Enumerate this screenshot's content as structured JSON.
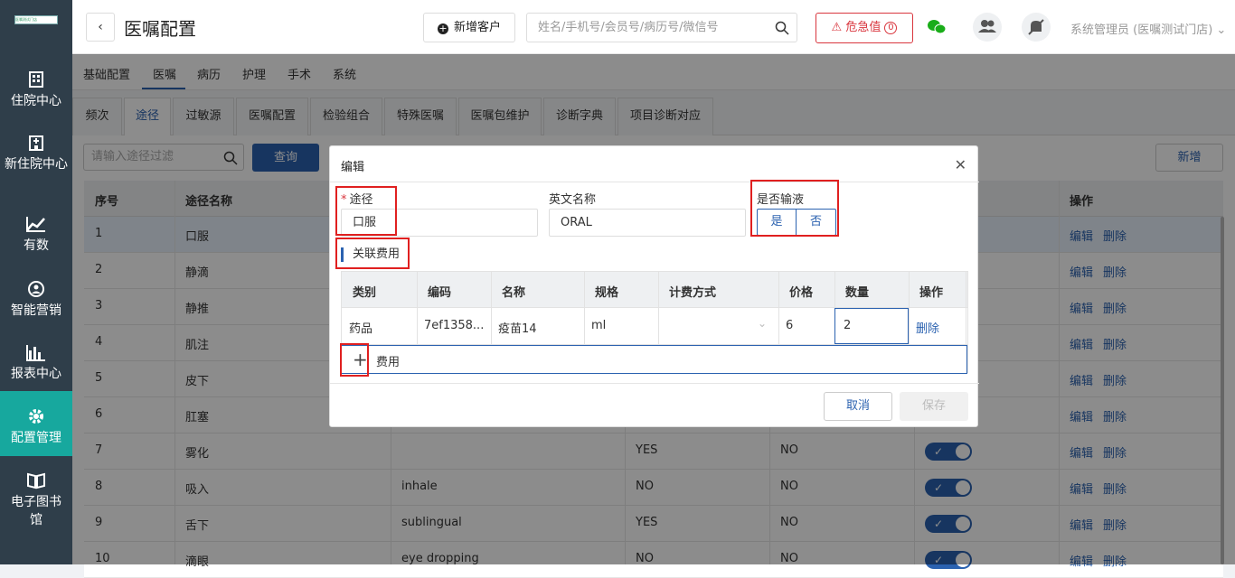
{
  "logo_text": "医嘱测试门店",
  "sidebar": {
    "items": [
      {
        "label": "住院中心",
        "icon": "building-icon"
      },
      {
        "label": "新住院中心",
        "icon": "hospital-icon"
      },
      {
        "label": "有数",
        "icon": "trend-chart-icon"
      },
      {
        "label": "智能营销",
        "icon": "marketing-icon"
      },
      {
        "label": "报表中心",
        "icon": "bar-chart-icon"
      },
      {
        "label": "配置管理",
        "icon": "gear-icon",
        "active": true
      },
      {
        "label": "电子图书馆",
        "icon": "book-icon"
      }
    ]
  },
  "header": {
    "title": "医嘱配置",
    "new_customer": "新增客户",
    "search_placeholder": "姓名/手机号/会员号/病历号/微信号",
    "critical_label": "危急值",
    "critical_count": "0",
    "user": "系统管理员 (医嘱测试门店)"
  },
  "tabs_main": [
    "基础配置",
    "医嘱",
    "病历",
    "护理",
    "手术",
    "系统"
  ],
  "tabs_sub": [
    "频次",
    "途径",
    "过敏源",
    "医嘱配置",
    "检验组合",
    "特殊医嘱",
    "医嘱包维护",
    "诊断字典",
    "项目诊断对应"
  ],
  "toolbar": {
    "filter_placeholder": "请输入途径过滤",
    "query": "查询",
    "add": "新增"
  },
  "table": {
    "headers": {
      "no": "序号",
      "name": "途径名称",
      "op": "操作"
    },
    "edit": "编辑",
    "delete": "删除",
    "rows": [
      {
        "no": "1",
        "name": "口服",
        "en": "",
        "yn1": "",
        "yn2": ""
      },
      {
        "no": "2",
        "name": "静滴",
        "en": "",
        "yn1": "",
        "yn2": ""
      },
      {
        "no": "3",
        "name": "静推",
        "en": "",
        "yn1": "",
        "yn2": ""
      },
      {
        "no": "4",
        "name": "肌注",
        "en": "",
        "yn1": "",
        "yn2": ""
      },
      {
        "no": "5",
        "name": "皮下",
        "en": "",
        "yn1": "",
        "yn2": ""
      },
      {
        "no": "6",
        "name": "肛塞",
        "en": "",
        "yn1": "",
        "yn2": ""
      },
      {
        "no": "7",
        "name": "雾化",
        "en": "",
        "yn1": "YES",
        "yn2": "NO"
      },
      {
        "no": "8",
        "name": "吸入",
        "en": "inhale",
        "yn1": "NO",
        "yn2": "NO"
      },
      {
        "no": "9",
        "name": "舌下",
        "en": "sublingual",
        "yn1": "YES",
        "yn2": "NO"
      },
      {
        "no": "10",
        "name": "滴眼",
        "en": "eye dropping",
        "yn1": "NO",
        "yn2": "NO"
      }
    ]
  },
  "modal": {
    "title": "编辑",
    "route_label": "途径",
    "route_value": "口服",
    "en_label": "英文名称",
    "en_value": "ORAL",
    "infusion_label": "是否输液",
    "yes": "是",
    "no": "否",
    "section_title": "关联费用",
    "grid_headers": [
      "类别",
      "编码",
      "名称",
      "规格",
      "计费方式",
      "价格",
      "数量",
      "操作"
    ],
    "grid_row": {
      "category": "药品",
      "code": "7ef1358...",
      "name": "疫苗14",
      "spec": "ml",
      "billing": "",
      "price": "6",
      "qty": "2",
      "op": "删除"
    },
    "add_fee": "费用",
    "cancel": "取消",
    "save": "保存"
  }
}
